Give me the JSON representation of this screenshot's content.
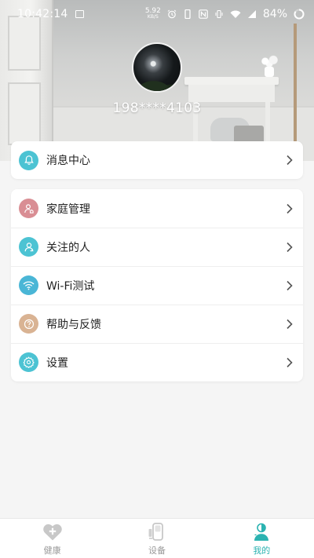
{
  "status_bar": {
    "time": "10:42:14",
    "net_speed": "5.92",
    "net_speed_unit": "KB/S",
    "battery": "84%"
  },
  "profile": {
    "phone": "198****4103"
  },
  "messages": {
    "label": "消息中心",
    "icon": "bell-icon",
    "icon_color": "#4cc3d3"
  },
  "menu": {
    "items": [
      {
        "label": "家庭管理",
        "icon": "family-icon",
        "icon_color": "#d98e94"
      },
      {
        "label": "关注的人",
        "icon": "person-icon",
        "icon_color": "#4cc3d3"
      },
      {
        "label": "Wi-Fi测试",
        "icon": "wifi-icon",
        "icon_color": "#4ab6d6"
      },
      {
        "label": "帮助与反馈",
        "icon": "help-icon",
        "icon_color": "#d9b393"
      },
      {
        "label": "设置",
        "icon": "gear-icon",
        "icon_color": "#4cc3d3"
      }
    ]
  },
  "tabbar": {
    "tabs": [
      {
        "label": "健康",
        "icon": "heart-plus-icon",
        "active": false
      },
      {
        "label": "设备",
        "icon": "device-icon",
        "active": false
      },
      {
        "label": "我的",
        "icon": "profile-icon",
        "active": true
      }
    ],
    "active_color": "#2bb3b1",
    "inactive_color": "#999999"
  }
}
